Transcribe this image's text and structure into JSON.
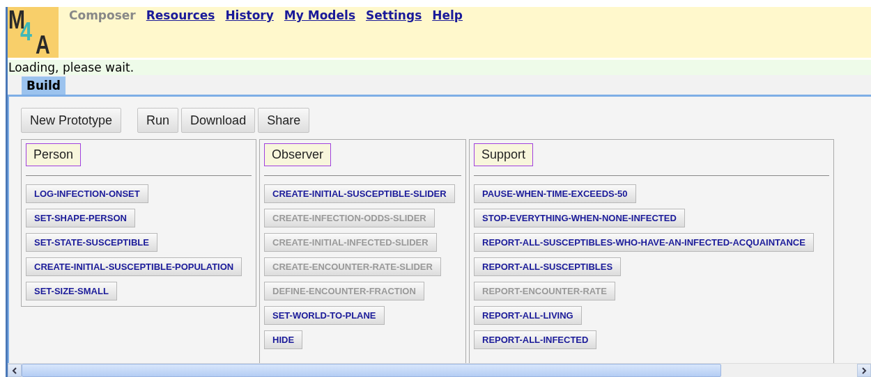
{
  "logo": {
    "text": "M4A"
  },
  "nav": [
    {
      "label": "Composer",
      "selected": true
    },
    {
      "label": "Resources",
      "selected": false
    },
    {
      "label": "History",
      "selected": false
    },
    {
      "label": "My Models",
      "selected": false
    },
    {
      "label": "Settings",
      "selected": false
    },
    {
      "label": "Help",
      "selected": false
    }
  ],
  "status": "Loading, please wait.",
  "tabs": [
    {
      "label": "Build",
      "selected": true
    }
  ],
  "toolbar": [
    {
      "label": "New Prototype"
    },
    {
      "label": "Run"
    },
    {
      "label": "Download"
    },
    {
      "label": "Share"
    }
  ],
  "columns": [
    {
      "title": "Person",
      "blocks": [
        {
          "label": "LOG-INFECTION-ONSET",
          "disabled": false
        },
        {
          "label": "SET-SHAPE-PERSON",
          "disabled": false
        },
        {
          "label": "SET-STATE-SUSCEPTIBLE",
          "disabled": false
        },
        {
          "label": "CREATE-INITIAL-SUSCEPTIBLE-POPULATION",
          "disabled": false
        },
        {
          "label": "SET-SIZE-SMALL",
          "disabled": false
        }
      ]
    },
    {
      "title": "Observer",
      "blocks": [
        {
          "label": "CREATE-INITIAL-SUSCEPTIBLE-SLIDER",
          "disabled": false
        },
        {
          "label": "CREATE-INFECTION-ODDS-SLIDER",
          "disabled": true
        },
        {
          "label": "CREATE-INITIAL-INFECTED-SLIDER",
          "disabled": true
        },
        {
          "label": "CREATE-ENCOUNTER-RATE-SLIDER",
          "disabled": true
        },
        {
          "label": "DEFINE-ENCOUNTER-FRACTION",
          "disabled": true
        },
        {
          "label": "SET-WORLD-TO-PLANE",
          "disabled": false
        },
        {
          "label": "HIDE",
          "disabled": false
        }
      ]
    },
    {
      "title": "Support",
      "blocks": [
        {
          "label": "PAUSE-WHEN-TIME-EXCEEDS-50",
          "disabled": false
        },
        {
          "label": "STOP-EVERYTHING-WHEN-NONE-INFECTED",
          "disabled": false
        },
        {
          "label": "REPORT-ALL-SUSCEPTIBLES-WHO-HAVE-AN-INFECTED-ACQUAINTANCE",
          "disabled": false
        },
        {
          "label": "REPORT-ALL-SUSCEPTIBLES",
          "disabled": false
        },
        {
          "label": "REPORT-ENCOUNTER-RATE",
          "disabled": true
        },
        {
          "label": "REPORT-ALL-LIVING",
          "disabled": false
        },
        {
          "label": "REPORT-ALL-INFECTED",
          "disabled": false
        }
      ]
    }
  ]
}
